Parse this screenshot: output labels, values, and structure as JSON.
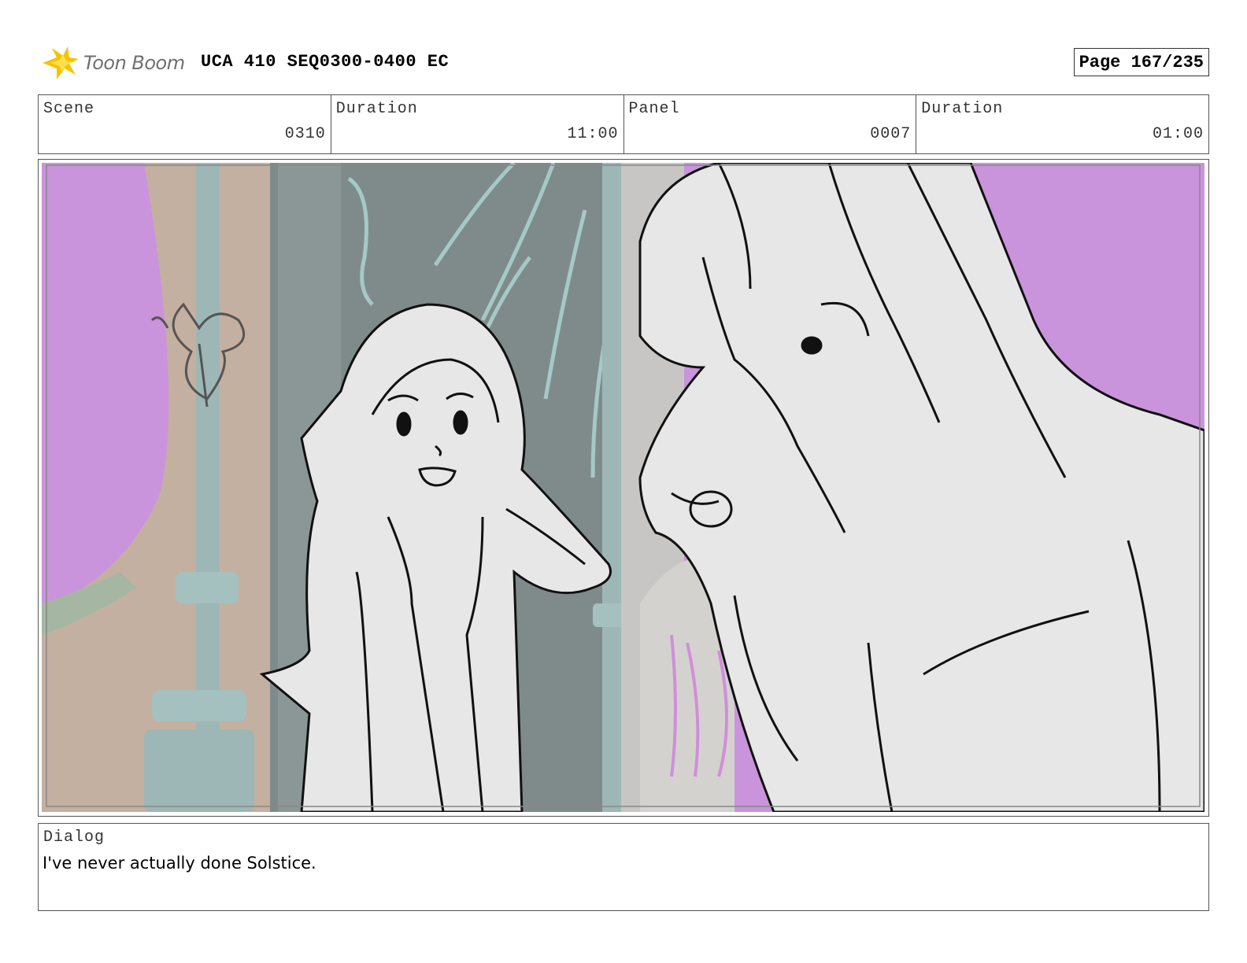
{
  "header": {
    "logo_text": "Toon Boom",
    "project_title": "UCA 410 SEQ0300-0400 EC",
    "page_indicator": "Page 167/235"
  },
  "info": {
    "scene_label": "Scene",
    "scene_value": "0310",
    "scene_duration_label": "Duration",
    "scene_duration_value": "11:00",
    "panel_label": "Panel",
    "panel_value": "0007",
    "panel_duration_label": "Duration",
    "panel_duration_value": "01:00"
  },
  "dialog": {
    "label": "Dialog",
    "text": "I've never actually done Solstice."
  },
  "colors": {
    "sky": "#c994dc",
    "wall": "#c4b0a0",
    "pillar": "#9cb7b6",
    "sketch_fill": "#e7e7e7",
    "logo_flame": "#f5c400"
  }
}
